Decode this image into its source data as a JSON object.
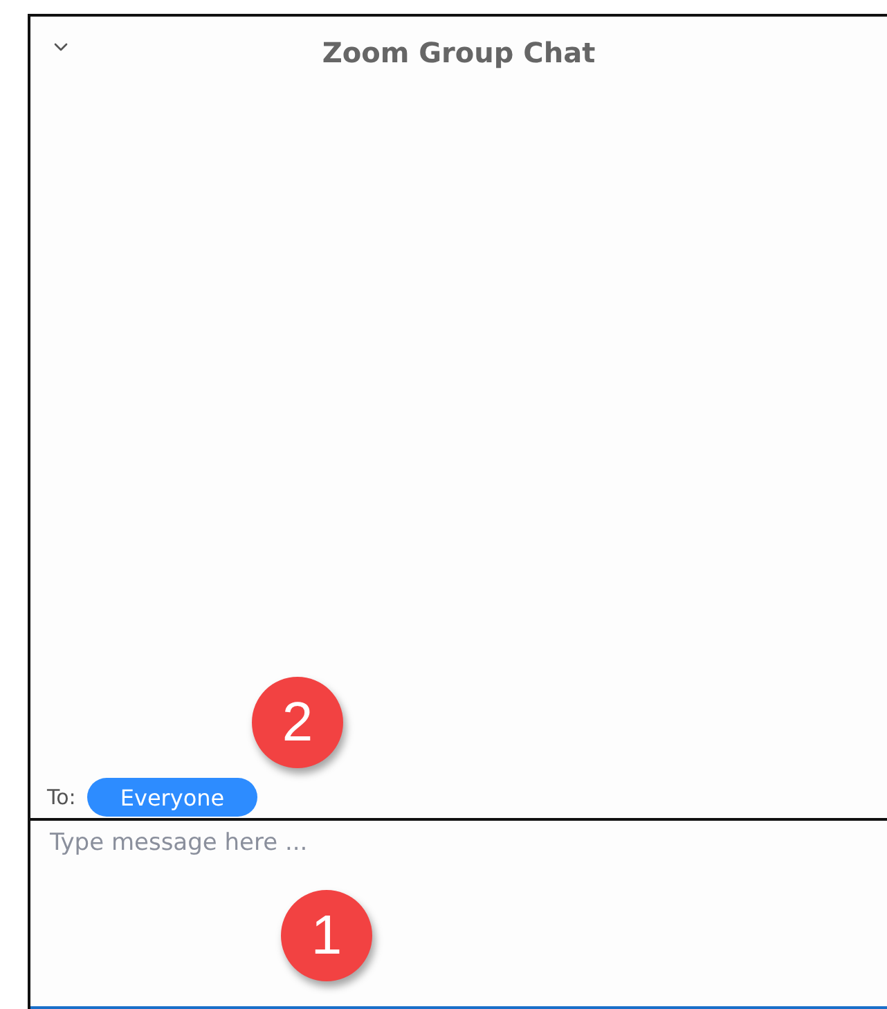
{
  "panel": {
    "title": "Zoom Group Chat"
  },
  "recipient": {
    "label": "To:",
    "value": "Everyone",
    "callout": "2"
  },
  "message": {
    "placeholder": "Type message here ...",
    "callout": "1"
  }
}
